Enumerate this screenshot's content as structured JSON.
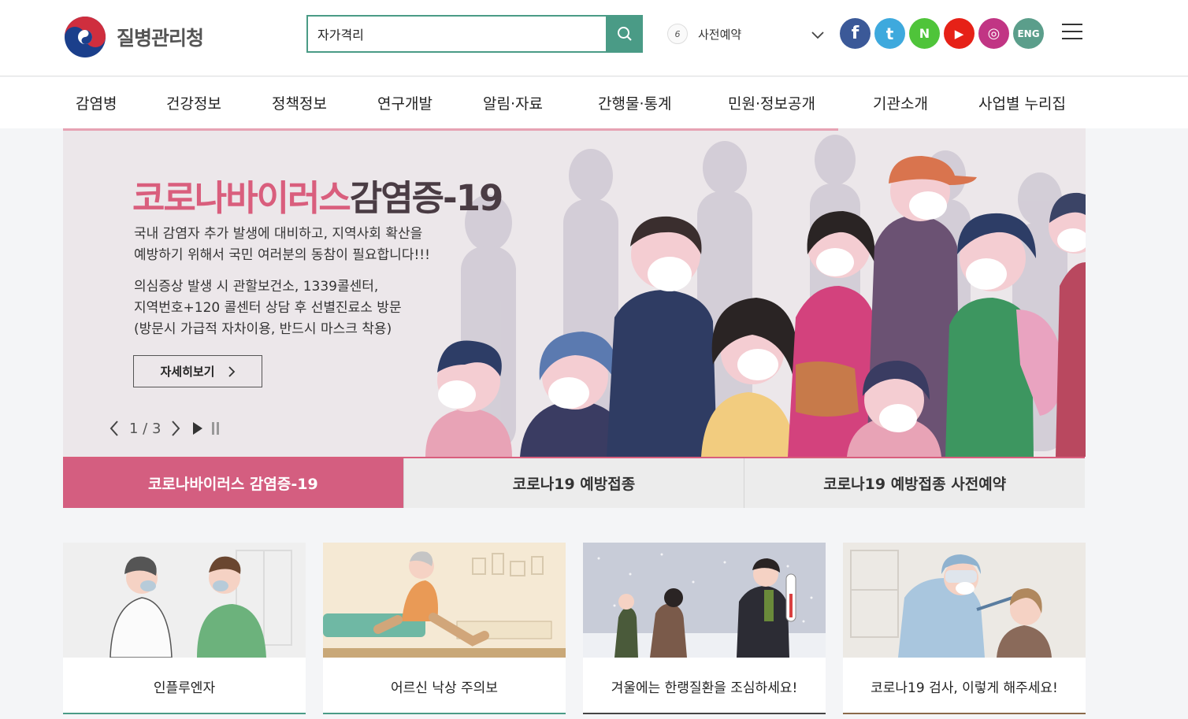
{
  "header": {
    "logo_text": "질병관리청",
    "search": {
      "value": "자가격리",
      "placeholder": ""
    },
    "rolling": {
      "num": "6",
      "text": "사전예약"
    },
    "sns": [
      {
        "icon": "facebook-icon",
        "label": "f",
        "color": "#3b5998"
      },
      {
        "icon": "twitter-icon",
        "label": "t",
        "color": "#3ea9dd"
      },
      {
        "icon": "naver-post-icon",
        "label": "N",
        "color": "#4fc43a"
      },
      {
        "icon": "youtube-icon",
        "label": "▶",
        "color": "#e62117"
      },
      {
        "icon": "instagram-icon",
        "label": "◎",
        "color": "#c13584"
      },
      {
        "icon": "english-site-icon",
        "label": "ENG",
        "color": "#5b9e8b"
      }
    ]
  },
  "gnb": [
    "감염병",
    "건강정보",
    "정책정보",
    "연구개발",
    "알림·자료",
    "간행물·통계",
    "민원·정보공개",
    "기관소개",
    "사업별 누리집"
  ],
  "hero": {
    "title_pink": "코로나바이러스",
    "title_dark": "감염증-19",
    "desc_line1": "국내 감염자 추가 발생에 대비하고, 지역사회 확산을",
    "desc_line2": "예방하기 위해서 국민 여러분의 동참이 필요합니다!!!",
    "desc2_line1": "의심증상 발생 시 관할보건소, 1339콜센터,",
    "desc2_line2": "지역번호+120 콜센터 상담 후 선별진료소 방문",
    "desc2_line3": "(방문시 가급적 자차이용, 반드시 마스크 착용)",
    "detail_label": "자세히보기",
    "counter": "1 / 3"
  },
  "tabs": [
    {
      "label": "코로나바이러스 감염증-19",
      "active": true
    },
    {
      "label": "코로나19 예방접종",
      "active": false
    },
    {
      "label": "코로나19 예방접종 사전예약",
      "active": false
    }
  ],
  "cards": [
    {
      "label": "인플루엔자",
      "line_color": "#4a9b86"
    },
    {
      "label": "어르신 낙상 주의보",
      "line_color": "#4a9b86"
    },
    {
      "label": "겨울에는 한랭질환을 조심하세요!",
      "line_color": "#444"
    },
    {
      "label": "코로나19 검사, 이렇게 해주세요!",
      "line_color": "#8a6a4a"
    }
  ],
  "colors": {
    "accent": "#4a9b86",
    "pink": "#d45e80"
  }
}
